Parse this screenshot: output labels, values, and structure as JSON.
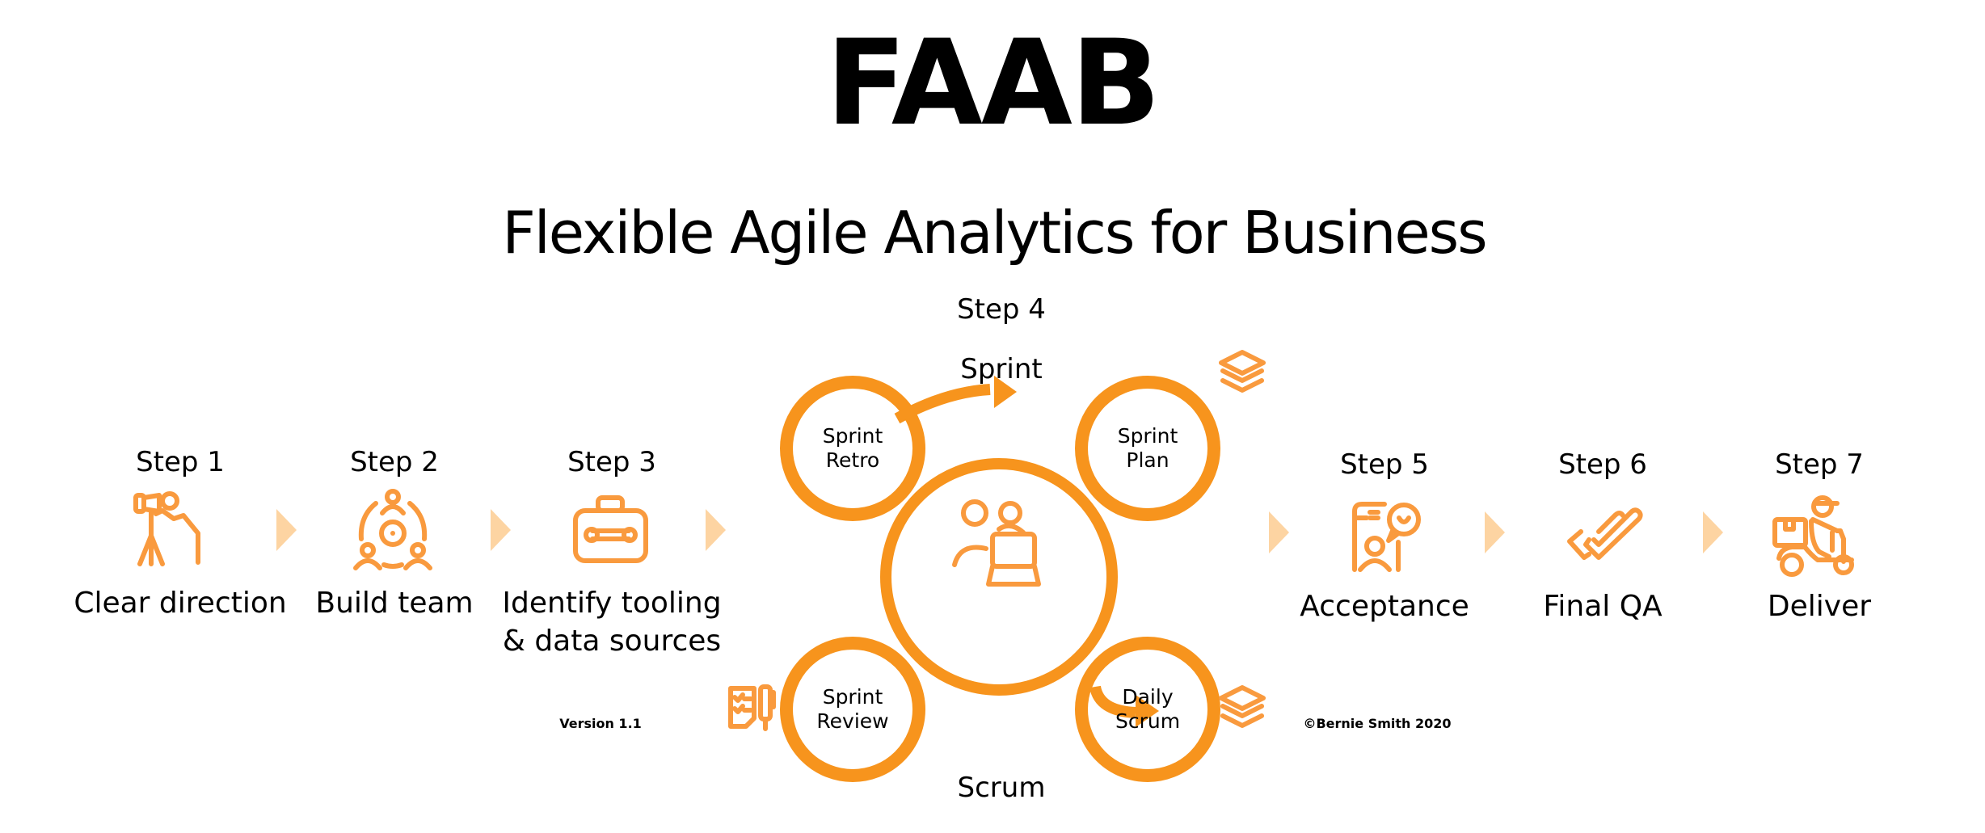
{
  "title": "FAAB",
  "subtitle": "Flexible Agile Analytics for Business",
  "colors": {
    "icon": "#F99A3E",
    "cycle": "#F7941D",
    "arrow": "#FDD4A2",
    "text": "#000000"
  },
  "steps": [
    {
      "label": "Step 1",
      "name": "Clear direction",
      "icon": "telescope-person-icon"
    },
    {
      "label": "Step 2",
      "name": "Build team",
      "icon": "team-gear-icon"
    },
    {
      "label": "Step 3",
      "name_lines": [
        "Identify tooling",
        "& data sources"
      ],
      "icon": "toolbox-icon"
    },
    {
      "label": "Step 4",
      "icon": "team-laptop-icon"
    },
    {
      "label": "Step 5",
      "name": "Acceptance",
      "icon": "phone-feedback-icon"
    },
    {
      "label": "Step 6",
      "name": "Final QA",
      "icon": "double-check-icon"
    },
    {
      "label": "Step 7",
      "name": "Deliver",
      "icon": "delivery-scooter-icon"
    }
  ],
  "sprint": {
    "top_label": "Sprint",
    "bottom_label": "Scrum",
    "stages": [
      {
        "lines": [
          "Sprint",
          "Retro"
        ]
      },
      {
        "lines": [
          "Sprint",
          "Plan"
        ]
      },
      {
        "lines": [
          "Sprint",
          "Review"
        ]
      },
      {
        "lines": [
          "Daily",
          "Scrum"
        ]
      }
    ]
  },
  "footer": {
    "version": "Version 1.1",
    "copyright": "©Bernie Smith 2020"
  }
}
